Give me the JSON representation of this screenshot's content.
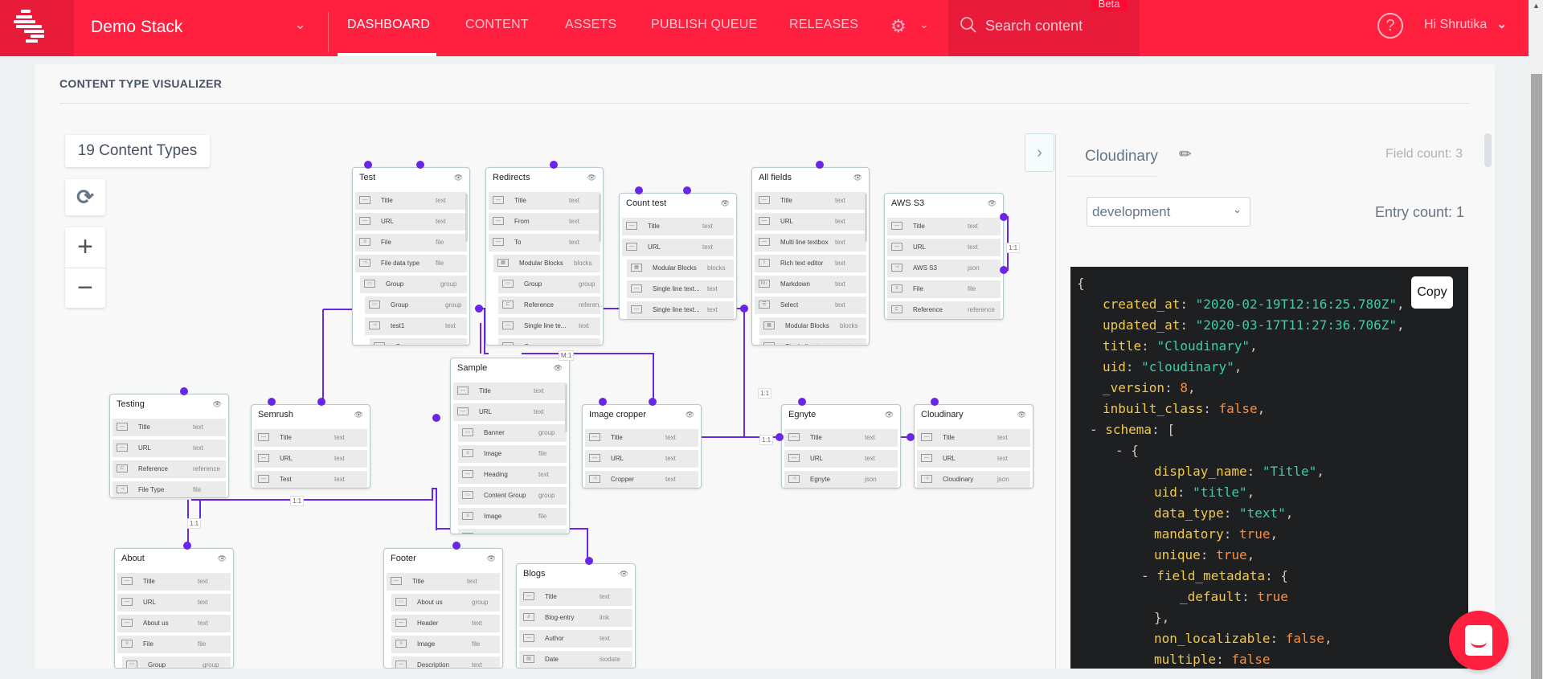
{
  "header": {
    "stack_name": "Demo Stack",
    "nav": [
      "DASHBOARD",
      "CONTENT",
      "ASSETS",
      "PUBLISH QUEUE",
      "RELEASES"
    ],
    "active_nav": "DASHBOARD",
    "search_placeholder": "Search content",
    "beta_label": "Beta",
    "help_label": "?",
    "greeting": "Hi  Shrutika",
    "brand_color": "#ff1f3f"
  },
  "page": {
    "title": "CONTENT TYPE VISUALIZER",
    "content_type_count": "19 Content Types",
    "refresh_icon": "refresh-icon",
    "zoom_in": "+",
    "zoom_out": "−"
  },
  "nodes": [
    {
      "title": "Test",
      "fields": [
        [
          "Title",
          "text",
          0,
          "t"
        ],
        [
          "URL",
          "text",
          0,
          "t"
        ],
        [
          "File",
          "file",
          0,
          "f"
        ],
        [
          "File data type",
          "file",
          0,
          "p"
        ],
        [
          "Group",
          "group",
          1,
          "g"
        ],
        [
          "Group",
          "group",
          2,
          "g"
        ],
        [
          "test1",
          "text",
          2,
          "p"
        ],
        [
          "Group",
          "group",
          3,
          "g"
        ]
      ]
    },
    {
      "title": "Redirects",
      "fields": [
        [
          "Title",
          "text",
          0,
          "t"
        ],
        [
          "From",
          "text",
          0,
          "t"
        ],
        [
          "To",
          "text",
          0,
          "t"
        ],
        [
          "Modular Blocks",
          "blocks",
          1,
          "m"
        ],
        [
          "Group",
          "group",
          2,
          "g"
        ],
        [
          "Reference",
          "referen...",
          2,
          "r"
        ],
        [
          "Single line te...",
          "text",
          2,
          "t"
        ],
        [
          "Group",
          "group",
          2,
          "g"
        ]
      ]
    },
    {
      "title": "Count test",
      "fields": [
        [
          "Title",
          "text",
          0,
          "t"
        ],
        [
          "URL",
          "text",
          0,
          "t"
        ],
        [
          "Modular Blocks",
          "blocks",
          1,
          "m"
        ],
        [
          "Single line text...",
          "text",
          1,
          "t"
        ],
        [
          "Single line text...",
          "text",
          1,
          "t"
        ]
      ]
    },
    {
      "title": "All fields",
      "fields": [
        [
          "Title",
          "text",
          0,
          "t"
        ],
        [
          "URL",
          "text",
          0,
          "t"
        ],
        [
          "Multi line textbox",
          "text",
          0,
          "t"
        ],
        [
          "Rich text editor",
          "text",
          0,
          "i"
        ],
        [
          "Markdown",
          "text",
          0,
          "md"
        ],
        [
          "Select",
          "text",
          0,
          "s"
        ],
        [
          "Modular Blocks",
          "blocks",
          1,
          "m"
        ],
        [
          "Single line tex...",
          "text",
          1,
          "t"
        ]
      ]
    },
    {
      "title": "AWS S3",
      "fields": [
        [
          "Title",
          "text",
          0,
          "t"
        ],
        [
          "URL",
          "text",
          0,
          "t"
        ],
        [
          "AWS S3",
          "json",
          0,
          "p"
        ],
        [
          "File",
          "file",
          0,
          "f"
        ],
        [
          "Reference",
          "reference",
          0,
          "r"
        ]
      ]
    },
    {
      "title": "Testing",
      "fields": [
        [
          "Title",
          "text",
          0,
          "t"
        ],
        [
          "URL",
          "text",
          0,
          "t"
        ],
        [
          "Reference",
          "reference",
          0,
          "r"
        ],
        [
          "File Type",
          "file",
          0,
          "p"
        ]
      ]
    },
    {
      "title": "Semrush",
      "fields": [
        [
          "Title",
          "text",
          0,
          "t"
        ],
        [
          "URL",
          "text",
          0,
          "t"
        ],
        [
          "Test",
          "text",
          0,
          "t"
        ]
      ]
    },
    {
      "title": "Sample",
      "fields": [
        [
          "Title",
          "text",
          0,
          "t"
        ],
        [
          "URL",
          "text",
          0,
          "t"
        ],
        [
          "Banner",
          "group",
          1,
          "g"
        ],
        [
          "Image",
          "file",
          1,
          "f"
        ],
        [
          "Heading",
          "text",
          1,
          "t"
        ],
        [
          "Content Group",
          "group",
          1,
          "g"
        ],
        [
          "Image",
          "file",
          1,
          "f"
        ],
        [
          "Title",
          "text",
          1,
          "t"
        ]
      ]
    },
    {
      "title": "Image cropper",
      "fields": [
        [
          "Title",
          "text",
          0,
          "t"
        ],
        [
          "URL",
          "text",
          0,
          "t"
        ],
        [
          "Cropper",
          "text",
          0,
          "p"
        ]
      ]
    },
    {
      "title": "Egnyte",
      "fields": [
        [
          "Title",
          "text",
          0,
          "t"
        ],
        [
          "URL",
          "text",
          0,
          "t"
        ],
        [
          "Egnyte",
          "json",
          0,
          "p"
        ]
      ]
    },
    {
      "title": "Cloudinary",
      "fields": [
        [
          "Title",
          "text",
          0,
          "t"
        ],
        [
          "URL",
          "text",
          0,
          "t"
        ],
        [
          "Cloudinary",
          "json",
          0,
          "p"
        ]
      ]
    },
    {
      "title": "About",
      "fields": [
        [
          "Title",
          "text",
          0,
          "t"
        ],
        [
          "URL",
          "text",
          0,
          "t"
        ],
        [
          "About us",
          "text",
          0,
          "t"
        ],
        [
          "File",
          "file",
          0,
          "f"
        ],
        [
          "Group",
          "group",
          1,
          "g"
        ]
      ]
    },
    {
      "title": "Footer",
      "fields": [
        [
          "Title",
          "text",
          0,
          "t"
        ],
        [
          "About us",
          "group",
          1,
          "g"
        ],
        [
          "Header",
          "text",
          1,
          "t"
        ],
        [
          "Image",
          "file",
          1,
          "f"
        ],
        [
          "Description",
          "text",
          1,
          "t"
        ]
      ]
    },
    {
      "title": "Blogs",
      "fields": [
        [
          "Title",
          "text",
          0,
          "t"
        ],
        [
          "Blog-entry",
          "link",
          0,
          "l"
        ],
        [
          "Author",
          "text",
          0,
          "t"
        ],
        [
          "Date",
          "isodate",
          0,
          "d"
        ]
      ]
    }
  ],
  "relations": [
    "1:1",
    "1:1",
    "M:1",
    "1:1",
    "1:1",
    "1:1"
  ],
  "panel": {
    "name": "Cloudinary",
    "field_count": "Field count: 3",
    "environment": "development",
    "entry_count": "Entry count: 1",
    "copy_label": "Copy",
    "json_lines": [
      [
        0,
        [
          [
            "p",
            "{"
          ]
        ]
      ],
      [
        1,
        [
          [
            "k",
            "created_at"
          ],
          [
            "p",
            ": "
          ],
          [
            "s",
            "\"2020-02-19T12:16:25.780Z\""
          ],
          [
            "p",
            ","
          ]
        ]
      ],
      [
        1,
        [
          [
            "k",
            "updated_at"
          ],
          [
            "p",
            ": "
          ],
          [
            "s",
            "\"2020-03-17T11:27:36.706Z\""
          ],
          [
            "p",
            ","
          ]
        ]
      ],
      [
        1,
        [
          [
            "k",
            "title"
          ],
          [
            "p",
            ": "
          ],
          [
            "s",
            "\"Cloudinary\""
          ],
          [
            "p",
            ","
          ]
        ]
      ],
      [
        1,
        [
          [
            "k",
            "uid"
          ],
          [
            "p",
            ": "
          ],
          [
            "s",
            "\"cloudinary\""
          ],
          [
            "p",
            ","
          ]
        ]
      ],
      [
        1,
        [
          [
            "k",
            "_version"
          ],
          [
            "p",
            ": "
          ],
          [
            "n",
            "8"
          ],
          [
            "p",
            ","
          ]
        ]
      ],
      [
        1,
        [
          [
            "k",
            "inbuilt_class"
          ],
          [
            "p",
            ": "
          ],
          [
            "n",
            "false"
          ],
          [
            "p",
            ","
          ]
        ]
      ],
      [
        1,
        [
          [
            "p",
            "- "
          ],
          [
            "k",
            "schema"
          ],
          [
            "p",
            ": ["
          ]
        ]
      ],
      [
        2,
        [
          [
            "p",
            "- {"
          ]
        ]
      ],
      [
        3,
        [
          [
            "k",
            "display_name"
          ],
          [
            "p",
            ": "
          ],
          [
            "s",
            "\"Title\""
          ],
          [
            "p",
            ","
          ]
        ]
      ],
      [
        3,
        [
          [
            "k",
            "uid"
          ],
          [
            "p",
            ": "
          ],
          [
            "s",
            "\"title\""
          ],
          [
            "p",
            ","
          ]
        ]
      ],
      [
        3,
        [
          [
            "k",
            "data_type"
          ],
          [
            "p",
            ": "
          ],
          [
            "s",
            "\"text\""
          ],
          [
            "p",
            ","
          ]
        ]
      ],
      [
        3,
        [
          [
            "k",
            "mandatory"
          ],
          [
            "p",
            ": "
          ],
          [
            "n",
            "true"
          ],
          [
            "p",
            ","
          ]
        ]
      ],
      [
        3,
        [
          [
            "k",
            "unique"
          ],
          [
            "p",
            ": "
          ],
          [
            "n",
            "true"
          ],
          [
            "p",
            ","
          ]
        ]
      ],
      [
        3,
        [
          [
            "p",
            "- "
          ],
          [
            "k",
            "field_metadata"
          ],
          [
            "p",
            ": {"
          ]
        ]
      ],
      [
        4,
        [
          [
            "k",
            "_default"
          ],
          [
            "p",
            ": "
          ],
          [
            "n",
            "true"
          ]
        ]
      ],
      [
        3,
        [
          [
            "p",
            "},"
          ]
        ]
      ],
      [
        3,
        [
          [
            "k",
            "non_localizable"
          ],
          [
            "p",
            ": "
          ],
          [
            "n",
            "false"
          ],
          [
            "p",
            ","
          ]
        ]
      ],
      [
        3,
        [
          [
            "k",
            "multiple"
          ],
          [
            "p",
            ": "
          ],
          [
            "n",
            "false"
          ]
        ]
      ]
    ]
  }
}
